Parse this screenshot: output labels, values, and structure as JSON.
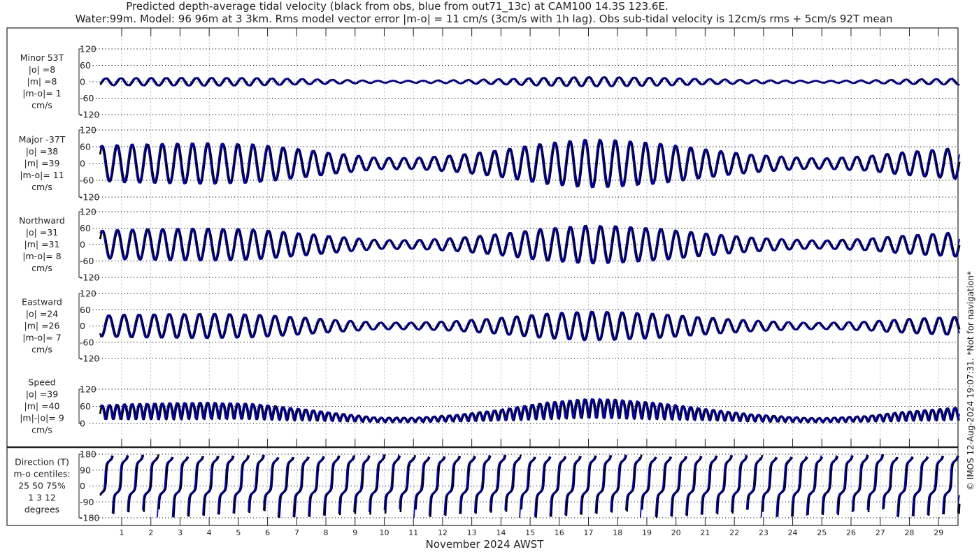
{
  "title": {
    "line1": "Predicted depth-average tidal velocity (black from obs, blue from out71_13c) at CAM100 14.3S 123.6E.",
    "line2": "Water:99m. Model: 96 96m at 3 3km. Rms model vector error |m-o| = 11 cm/s (3cm/s with 1h lag). Obs sub-tidal velocity is 12cm/s rms + 5cm/s 92T mean"
  },
  "copyright": "© IMOS 12-Aug-2024 19:07:31. *Not for navigation*",
  "colors": {
    "obs": "#000000",
    "model": "#0000ee",
    "grid": "#000000",
    "daygrid": "#c8d0ec"
  },
  "chart_data": {
    "type": "line",
    "title": "Predicted depth-average tidal velocity",
    "xlabel": "November 2024 AWST",
    "xlim": [
      0.26,
      29.73
    ],
    "x_ticks": [
      "1",
      "2",
      "3",
      "4",
      "5",
      "6",
      "7",
      "8",
      "9",
      "10",
      "11",
      "12",
      "13",
      "14",
      "15",
      "16",
      "17",
      "18",
      "19",
      "20",
      "21",
      "22",
      "23",
      "24",
      "25",
      "26",
      "27",
      "28",
      "29"
    ],
    "legend": [
      "obs (black)",
      "model (blue)"
    ],
    "tidal_period_days": 0.5175,
    "major_amplitude_envelope": {
      "days": [
        0.26,
        1,
        2.5,
        4,
        5.5,
        7,
        8.5,
        9.8,
        11,
        12.5,
        14,
        15.5,
        17,
        18,
        19.5,
        21,
        22.5,
        24,
        25,
        26.5,
        28,
        29.73
      ],
      "cm_s": [
        62,
        66,
        70,
        72,
        68,
        52,
        34,
        20,
        20,
        30,
        48,
        72,
        85,
        82,
        70,
        50,
        33,
        22,
        18,
        26,
        42,
        55
      ]
    },
    "panels": [
      {
        "id": "minor",
        "label": [
          "Minor 53T",
          "|o| =8",
          "|m| =8",
          "|m-o|= 1",
          "cm/s"
        ],
        "ticks": [
          "120",
          "60",
          "0",
          "-60",
          "-120"
        ],
        "ylim": [
          -120,
          120
        ]
      },
      {
        "id": "major",
        "label": [
          "Major -37T",
          "|o| =38",
          "|m| =39",
          "|m-o|= 11",
          "cm/s"
        ],
        "ticks": [
          "120",
          "60",
          "0",
          "-60",
          "-120"
        ],
        "ylim": [
          -120,
          120
        ]
      },
      {
        "id": "north",
        "label": [
          "Northward",
          "|o| =31",
          "|m| =31",
          "|m-o|= 8",
          "cm/s"
        ],
        "ticks": [
          "120",
          "60",
          "0",
          "-60",
          "-120"
        ],
        "ylim": [
          -120,
          120
        ]
      },
      {
        "id": "east",
        "label": [
          "Eastward",
          "|o| =24",
          "|m| =26",
          "|m-o|= 7",
          "cm/s"
        ],
        "ticks": [
          "120",
          "60",
          "0",
          "-60",
          "-120"
        ],
        "ylim": [
          -120,
          120
        ]
      },
      {
        "id": "speed",
        "label": [
          "Speed",
          "|o| =39",
          "|m| =40",
          "|m|-|o|= 9",
          "cm/s"
        ],
        "ticks": [
          "120",
          "60",
          "0"
        ],
        "ylim": [
          0,
          120
        ]
      },
      {
        "id": "direction",
        "label": [
          "Direction (T)",
          "m-o centiles:",
          "25  50  75%",
          "1    3   12",
          "degrees"
        ],
        "ticks": [
          "180",
          "90",
          "0",
          "-90",
          "-180"
        ],
        "ylim": [
          -180,
          180
        ]
      }
    ]
  }
}
